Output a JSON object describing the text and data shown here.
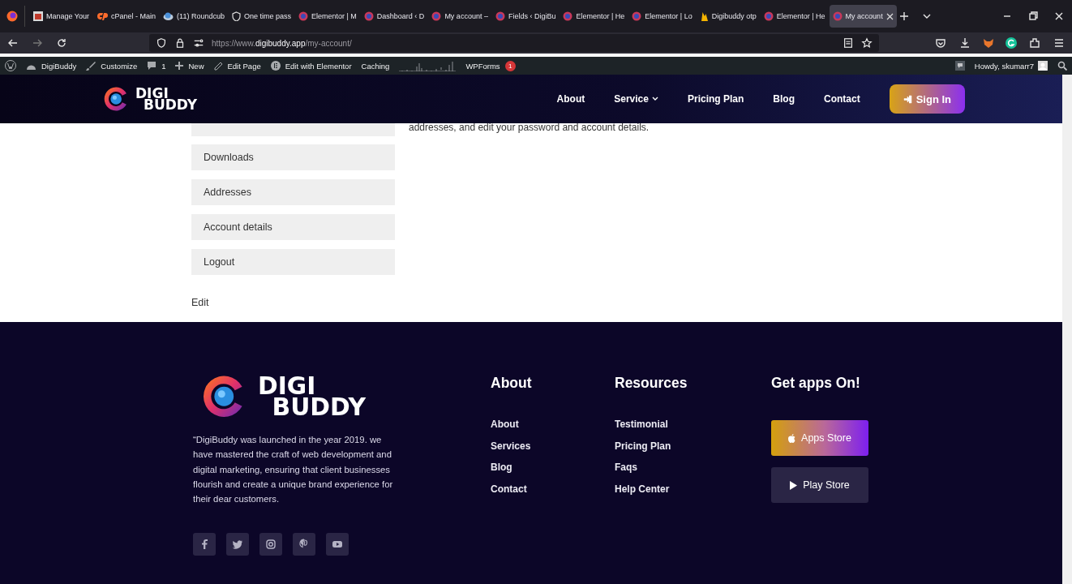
{
  "browser": {
    "tabs": [
      {
        "title": "Manage Your",
        "kind": "page",
        "selected": false
      },
      {
        "title": "cPanel - Main",
        "kind": "cpanel",
        "selected": false
      },
      {
        "title": "(11) Roundcub",
        "kind": "mail",
        "selected": false
      },
      {
        "title": "One time pass",
        "kind": "shield",
        "selected": false
      },
      {
        "title": "Elementor | M",
        "kind": "elementor",
        "selected": false
      },
      {
        "title": "Dashboard ‹ D",
        "kind": "elementor",
        "selected": false
      },
      {
        "title": "My account –",
        "kind": "elementor",
        "selected": false
      },
      {
        "title": "Fields ‹ DigiBu",
        "kind": "elementor",
        "selected": false
      },
      {
        "title": "Elementor | He",
        "kind": "elementor",
        "selected": false
      },
      {
        "title": "Elementor | Lo",
        "kind": "elementor",
        "selected": false
      },
      {
        "title": "Digibuddy otp",
        "kind": "fire",
        "selected": false
      },
      {
        "title": "Elementor | He",
        "kind": "elementor",
        "selected": false
      },
      {
        "title": "My account",
        "kind": "elementor",
        "selected": true
      }
    ],
    "url": {
      "scheme": "https://www.",
      "domain": "digibuddy.app",
      "path": "/my-account/"
    }
  },
  "admin_bar": {
    "items": [
      {
        "kind": "site",
        "label": "DigiBuddy"
      },
      {
        "kind": "customize",
        "label": "Customize"
      },
      {
        "kind": "comments",
        "label": "1"
      },
      {
        "kind": "new",
        "label": "New"
      },
      {
        "kind": "edit",
        "label": "Edit Page"
      },
      {
        "kind": "elementor",
        "label": "Edit with Elementor"
      },
      {
        "kind": "text",
        "label": "Caching"
      },
      {
        "kind": "graph"
      },
      {
        "kind": "wpforms",
        "label": "WPForms",
        "badge": "1"
      }
    ],
    "greeting": "Howdy, skumarr7"
  },
  "header": {
    "logo": {
      "line1": "DIGI",
      "line2": "BUDDY"
    },
    "nav": [
      {
        "label": "About",
        "dropdown": false
      },
      {
        "label": "Service",
        "dropdown": true
      },
      {
        "label": "Pricing Plan",
        "dropdown": false
      },
      {
        "label": "Blog",
        "dropdown": false
      },
      {
        "label": "Contact",
        "dropdown": false
      }
    ],
    "sign_in": "Sign In"
  },
  "account": {
    "menu": [
      "Downloads",
      "Addresses",
      "Account details",
      "Logout"
    ],
    "intro": "addresses, and edit your password and account details.",
    "edit": "Edit"
  },
  "footer": {
    "logo": {
      "line1": "DIGI",
      "line2": "BUDDY"
    },
    "description": "“DigiBuddy was launched in the year 2019. we have mastered the craft of web development and digital marketing, ensuring that client businesses flourish and create a unique brand experience for their dear customers.",
    "columns": [
      {
        "title": "About",
        "links": [
          "About",
          "Services",
          "Blog",
          "Contact"
        ]
      },
      {
        "title": "Resources",
        "links": [
          "Testimonial",
          "Pricing Plan",
          "Faqs",
          "Help Center"
        ]
      }
    ],
    "apps": {
      "title": "Get apps On!",
      "buttons": [
        {
          "kind": "apple",
          "label": "Apps Store"
        },
        {
          "kind": "play",
          "label": "Play Store"
        }
      ]
    }
  }
}
